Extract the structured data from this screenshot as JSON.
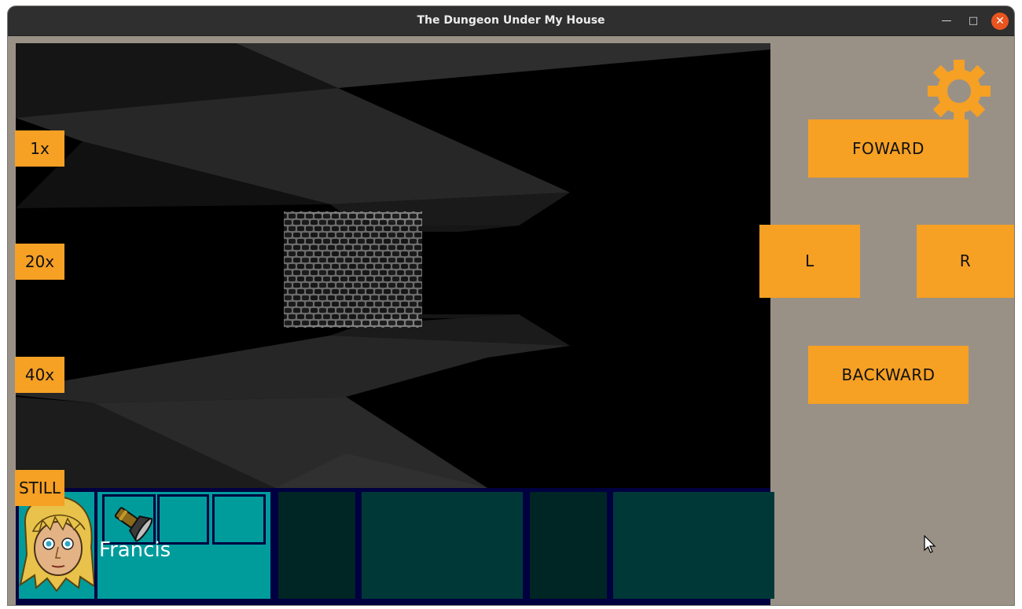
{
  "window": {
    "title": "The Dungeon Under My House"
  },
  "speed_controls": [
    {
      "label": "1x"
    },
    {
      "label": "20x"
    },
    {
      "label": "40x"
    },
    {
      "label": "STILL"
    }
  ],
  "movement": {
    "forward": "FOWARD",
    "left": "L",
    "right": "R",
    "backward": "BACKWARD"
  },
  "party": {
    "character": {
      "name": "Francis",
      "inventory": [
        {
          "item": "flashlight"
        },
        {
          "item": ""
        },
        {
          "item": ""
        }
      ]
    }
  },
  "icons": {
    "settings": "gear-icon",
    "flashlight": "flashlight-icon",
    "portrait": "portrait-francis"
  },
  "colors": {
    "button": "#f6a024",
    "panel_background": "#9a9186",
    "active_slot": "#009c9c",
    "inactive_slot_dark": "#002525",
    "inactive_slot": "#003838",
    "slot_border": "#000040"
  }
}
